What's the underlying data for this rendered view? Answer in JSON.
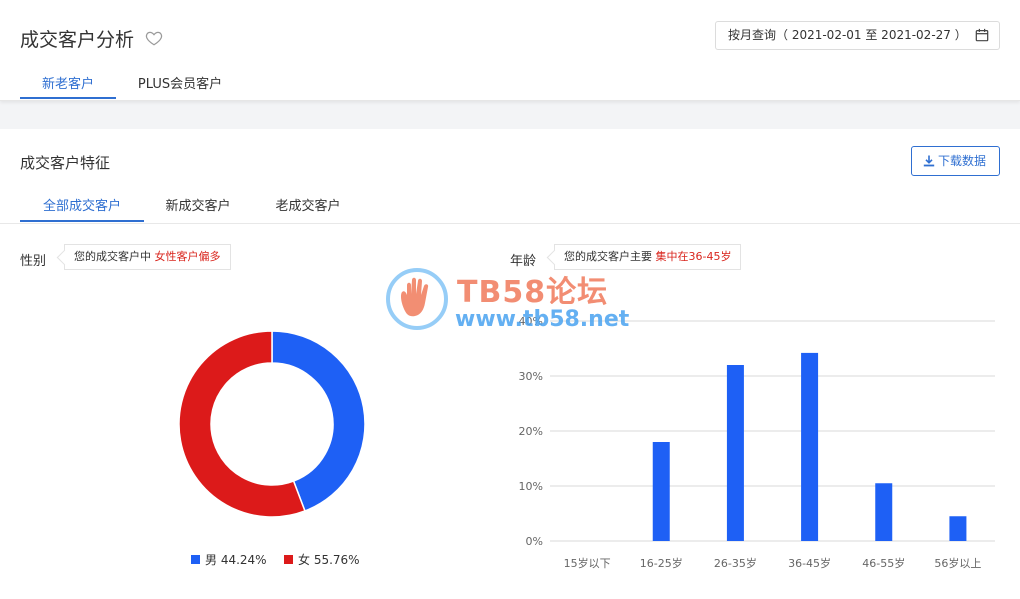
{
  "header": {
    "title": "成交客户分析",
    "date_range_label": "按月查询（ 2021-02-01 至 2021-02-27 ）",
    "tabs": [
      {
        "label": "新老客户",
        "active": true
      },
      {
        "label": "PLUS会员客户",
        "active": false
      }
    ]
  },
  "section": {
    "title": "成交客户特征",
    "download_label": "下载数据",
    "tabs": [
      {
        "label": "全部成交客户",
        "active": true
      },
      {
        "label": "新成交客户",
        "active": false
      },
      {
        "label": "老成交客户",
        "active": false
      }
    ]
  },
  "gender": {
    "label": "性别",
    "tip_prefix": "您的成交客户中",
    "tip_highlight": "女性客户偏多"
  },
  "age": {
    "label": "年龄",
    "tip_prefix": "您的成交客户主要",
    "tip_highlight": "集中在36-45岁"
  },
  "watermark": {
    "title": "TB58论坛",
    "url": "www.tb58.net"
  },
  "colors": {
    "accent": "#2f6fd1",
    "male": "#1e60f5",
    "female": "#dc1a1a",
    "highlight": "#d9251d"
  },
  "chart_data": [
    {
      "type": "pie",
      "title": "",
      "donut": true,
      "categories": [
        "男",
        "女"
      ],
      "values": [
        44.24,
        55.76
      ],
      "legend_labels": [
        "男 44.24%",
        "女 55.76%"
      ],
      "legend_position": "bottom"
    },
    {
      "type": "bar",
      "title": "",
      "categories": [
        "15岁以下",
        "16-25岁",
        "26-35岁",
        "36-45岁",
        "46-55岁",
        "56岁以上"
      ],
      "values": [
        0,
        18,
        32,
        34.2,
        10.5,
        4.5
      ],
      "ylim": [
        0,
        40
      ],
      "yticks": [
        "0%",
        "10%",
        "20%",
        "30%",
        "40%"
      ],
      "grid": true
    }
  ]
}
